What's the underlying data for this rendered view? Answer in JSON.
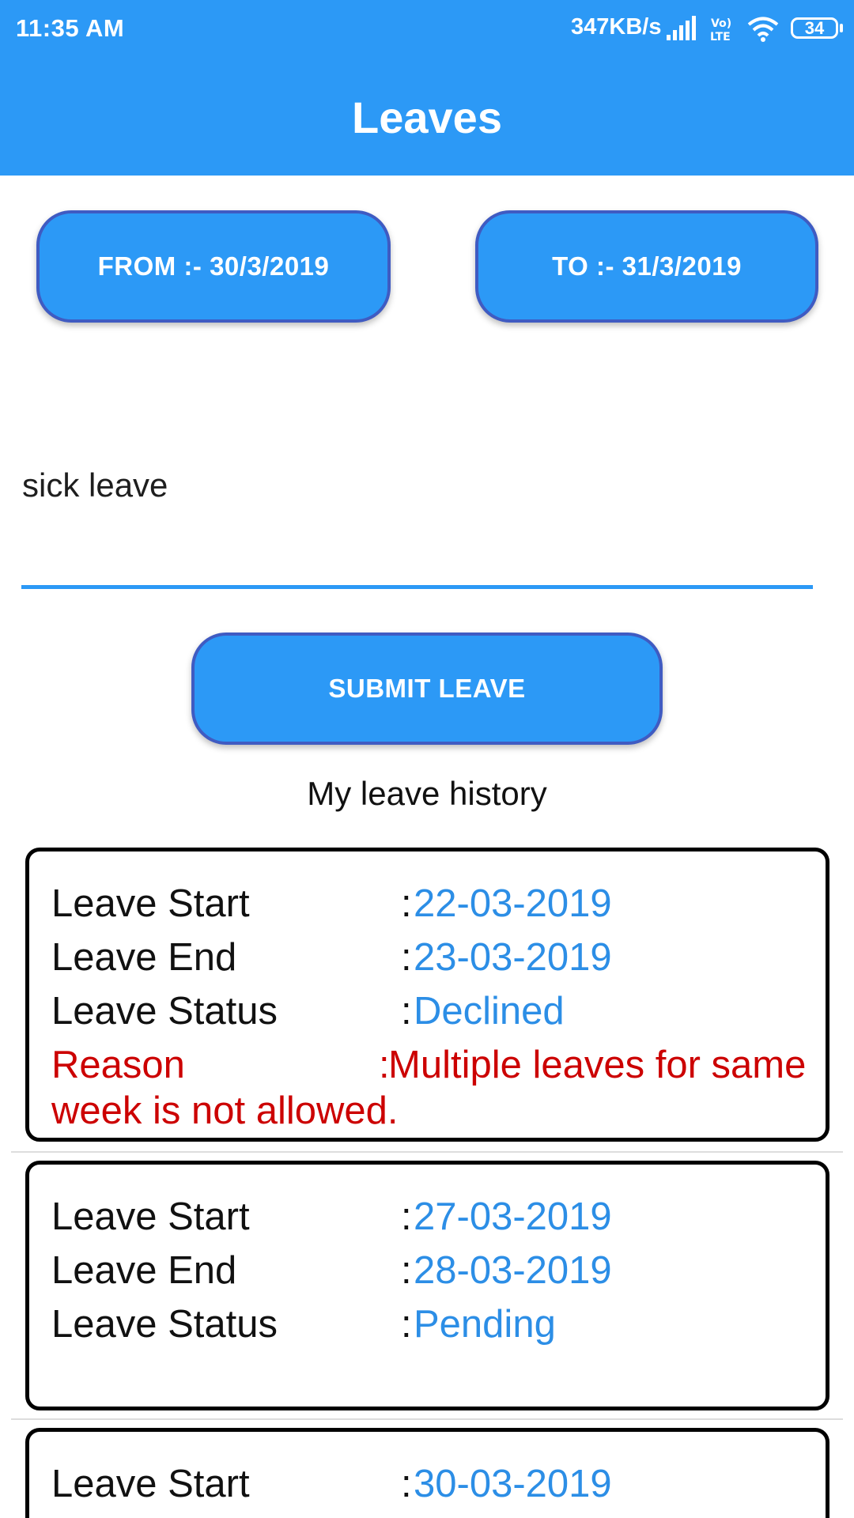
{
  "status_bar": {
    "time": "11:35 AM",
    "net_speed": "347KB/s",
    "volte": "Vo) LTE",
    "battery": "34"
  },
  "app_bar": {
    "title": "Leaves"
  },
  "date_range": {
    "from_label": "FROM :- 30/3/2019",
    "to_label": "TO :- 31/3/2019"
  },
  "reason_field": {
    "value": "sick leave"
  },
  "submit_label": "SUBMIT LEAVE",
  "history": {
    "title": "My leave history",
    "labels": {
      "start": "Leave Start",
      "end": "Leave End",
      "status": "Leave Status",
      "reason": "Reason",
      "colon": ":"
    },
    "items": [
      {
        "start": "22-03-2019",
        "end": "23-03-2019",
        "status": "Declined",
        "reason_line1": "Multiple leaves for same",
        "reason_line2": "week is not allowed."
      },
      {
        "start": "27-03-2019",
        "end": "28-03-2019",
        "status": "Pending"
      },
      {
        "start": "30-03-2019"
      }
    ]
  },
  "colors": {
    "primary": "#2c99f6",
    "button_border": "#3f5bc2",
    "value_blue": "#2c8ee6",
    "reason_red": "#cc0000"
  },
  "icons": [
    "signal-icon",
    "volte-icon",
    "wifi-icon",
    "battery-icon"
  ]
}
